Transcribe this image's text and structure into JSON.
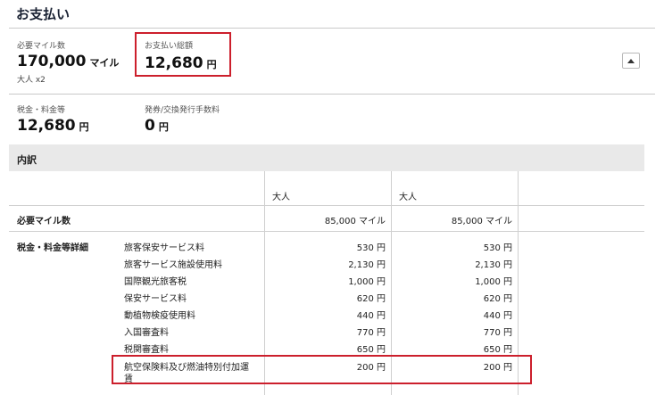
{
  "header": {
    "title": "お支払い"
  },
  "summary": {
    "miles_label": "必要マイル数",
    "miles_value": "170,000",
    "miles_unit": "マイル",
    "passengers": "大人 x2",
    "total_label": "お支払い総額",
    "total_value": "12,680",
    "total_unit": "円",
    "tax_label": "税金・料金等",
    "tax_value": "12,680",
    "tax_unit": "円",
    "fee_label": "発券/交換発行手数料",
    "fee_value": "0",
    "fee_unit": "円"
  },
  "breakdown": {
    "title": "内訳",
    "columns": [
      "大人",
      "大人"
    ],
    "miles_row": {
      "label": "必要マイル数",
      "values": [
        "85,000 マイル",
        "85,000 マイル"
      ]
    },
    "tax_group_label": "税金・料金等詳細",
    "tax_items": [
      {
        "name": "旅客保安サービス料",
        "values": [
          "530 円",
          "530 円"
        ]
      },
      {
        "name": "旅客サービス施設使用料",
        "values": [
          "2,130 円",
          "2,130 円"
        ]
      },
      {
        "name": "国際観光旅客税",
        "values": [
          "1,000 円",
          "1,000 円"
        ]
      },
      {
        "name": "保安サービス料",
        "values": [
          "620 円",
          "620 円"
        ]
      },
      {
        "name": "動植物検疫使用料",
        "values": [
          "440 円",
          "440 円"
        ]
      },
      {
        "name": "入国審査料",
        "values": [
          "770 円",
          "770 円"
        ]
      },
      {
        "name": "税関審査料",
        "values": [
          "650 円",
          "650 円"
        ]
      },
      {
        "name_line1": "航空保険料及び燃油特別付加運",
        "name_line2": "賃",
        "values": [
          "200 円",
          "200 円"
        ]
      }
    ]
  },
  "colors": {
    "highlight": "#cc1f2c",
    "band": "#e9e9e9",
    "text": "#222222"
  },
  "icons": {
    "toggle": "caret-up-icon"
  }
}
